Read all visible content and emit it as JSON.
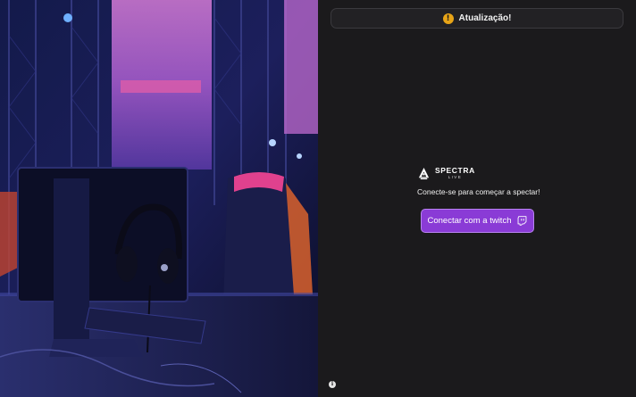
{
  "update_bar": {
    "icon": "alert-icon",
    "label": "Atualização!"
  },
  "brand": {
    "name": "SPECTRA",
    "sub": "LIVE",
    "logo_icon": "spectra-logo-icon"
  },
  "login": {
    "tagline": "Conecte-se para começar a spectar!",
    "button_label": "Conectar com a twitch",
    "button_icon": "twitch-icon"
  },
  "footer": {
    "info_icon": "info-icon"
  },
  "hero": {
    "description_icon": "gaming-setup-photo"
  },
  "colors": {
    "panel_bg": "#1b1a1c",
    "accent_purple": "#8a3bd6",
    "alert_orange": "#e7a417"
  }
}
